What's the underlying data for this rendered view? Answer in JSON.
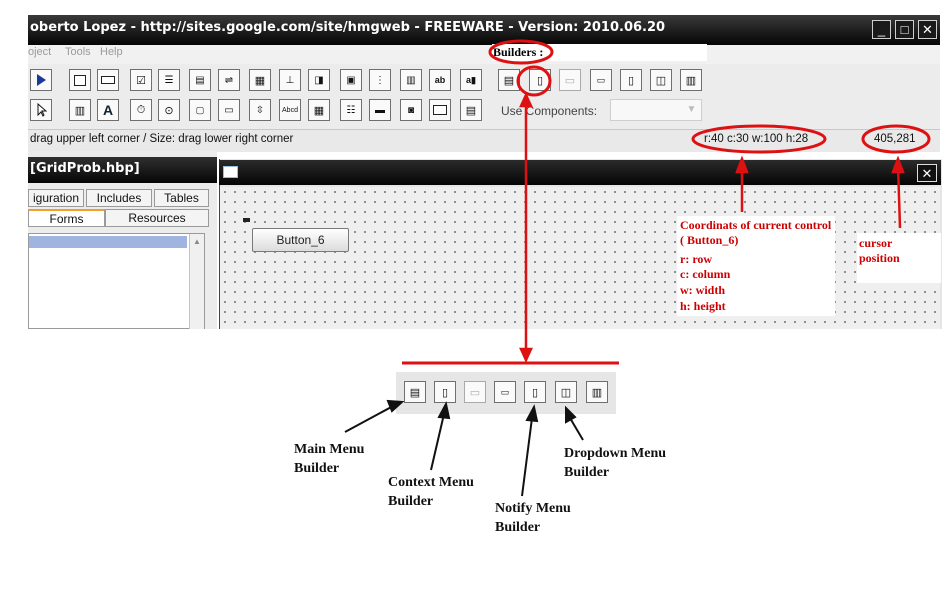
{
  "window": {
    "title": "oberto Lopez - http://sites.google.com/site/hmgweb - FREEWARE - Version: 2010.06.20",
    "minimize": "_",
    "maximize": "□",
    "close": "✕"
  },
  "menu": [
    "oject",
    "Tools",
    "Help"
  ],
  "toolbar": {
    "builders_label": "Builders :",
    "use_components_label": "Use Components:",
    "use_components_value": ""
  },
  "status": {
    "hint": "drag upper left corner / Size: drag lower right corner",
    "coords": "r:40 c:30 w:100 h:28",
    "cursor": "405,281"
  },
  "project": {
    "title": "[GridProb.hbp]",
    "tabs_row1": [
      "iguration",
      "Includes",
      "Tables"
    ],
    "tabs_row2": [
      "Forms",
      "Resources"
    ]
  },
  "form": {
    "close": "✕",
    "button_label": "Button_6"
  },
  "annotations": {
    "coords_title": "Coordinats of current control ( Button_6)",
    "coords_lines": [
      "r: row",
      "c: column",
      "w: width",
      "h: height"
    ],
    "cursor_note": "cursor position",
    "main_menu": "Main Menu Builder",
    "context_menu": "Context Menu Builder",
    "notify_menu": "Notify Menu Builder",
    "dropdown_menu": "Dropdown Menu Builder"
  },
  "colors": {
    "annotation_red": "#dd1111",
    "titlebar": "#0a0a0a",
    "grid": "#efefef"
  }
}
